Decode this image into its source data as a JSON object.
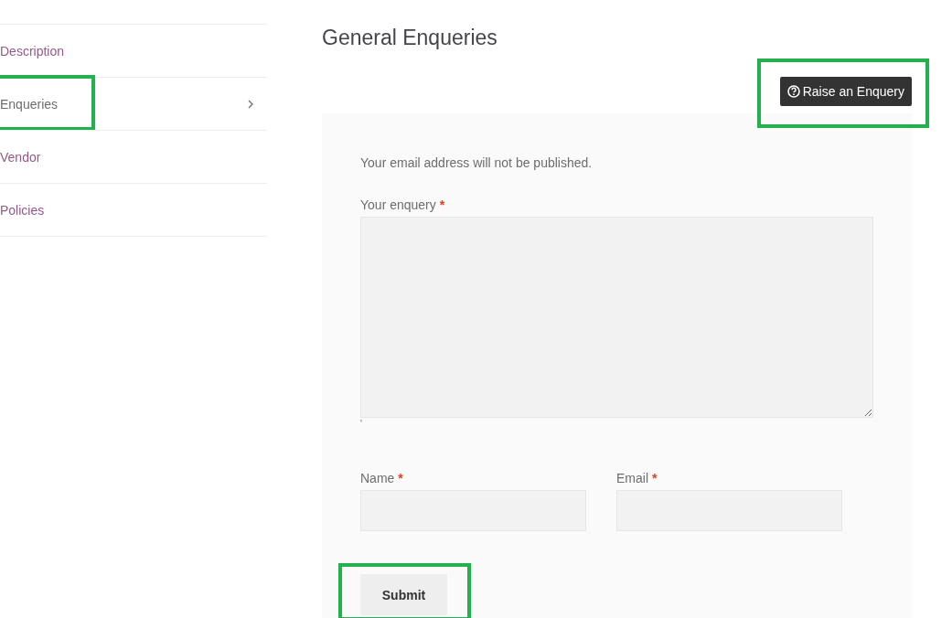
{
  "sidebar": {
    "items": [
      {
        "label": "Description",
        "selected": false,
        "highlighted": false
      },
      {
        "label": "Enqueries",
        "selected": true,
        "highlighted": true
      },
      {
        "label": "Vendor",
        "selected": false,
        "highlighted": false
      },
      {
        "label": "Policies",
        "selected": false,
        "highlighted": false
      }
    ]
  },
  "heading": "General Enqueries",
  "raise_button": {
    "label": "Raise an Enquery",
    "highlighted": true
  },
  "form": {
    "notice": "Your email address will not be published.",
    "enquiry": {
      "label": "Your enquery",
      "required_mark": "*"
    },
    "enquiry_note": "'",
    "fields": [
      {
        "label": "Name",
        "required_mark": "*"
      },
      {
        "label": "Email",
        "required_mark": "*"
      }
    ],
    "submit": {
      "label": "Submit",
      "highlighted": true
    }
  }
}
